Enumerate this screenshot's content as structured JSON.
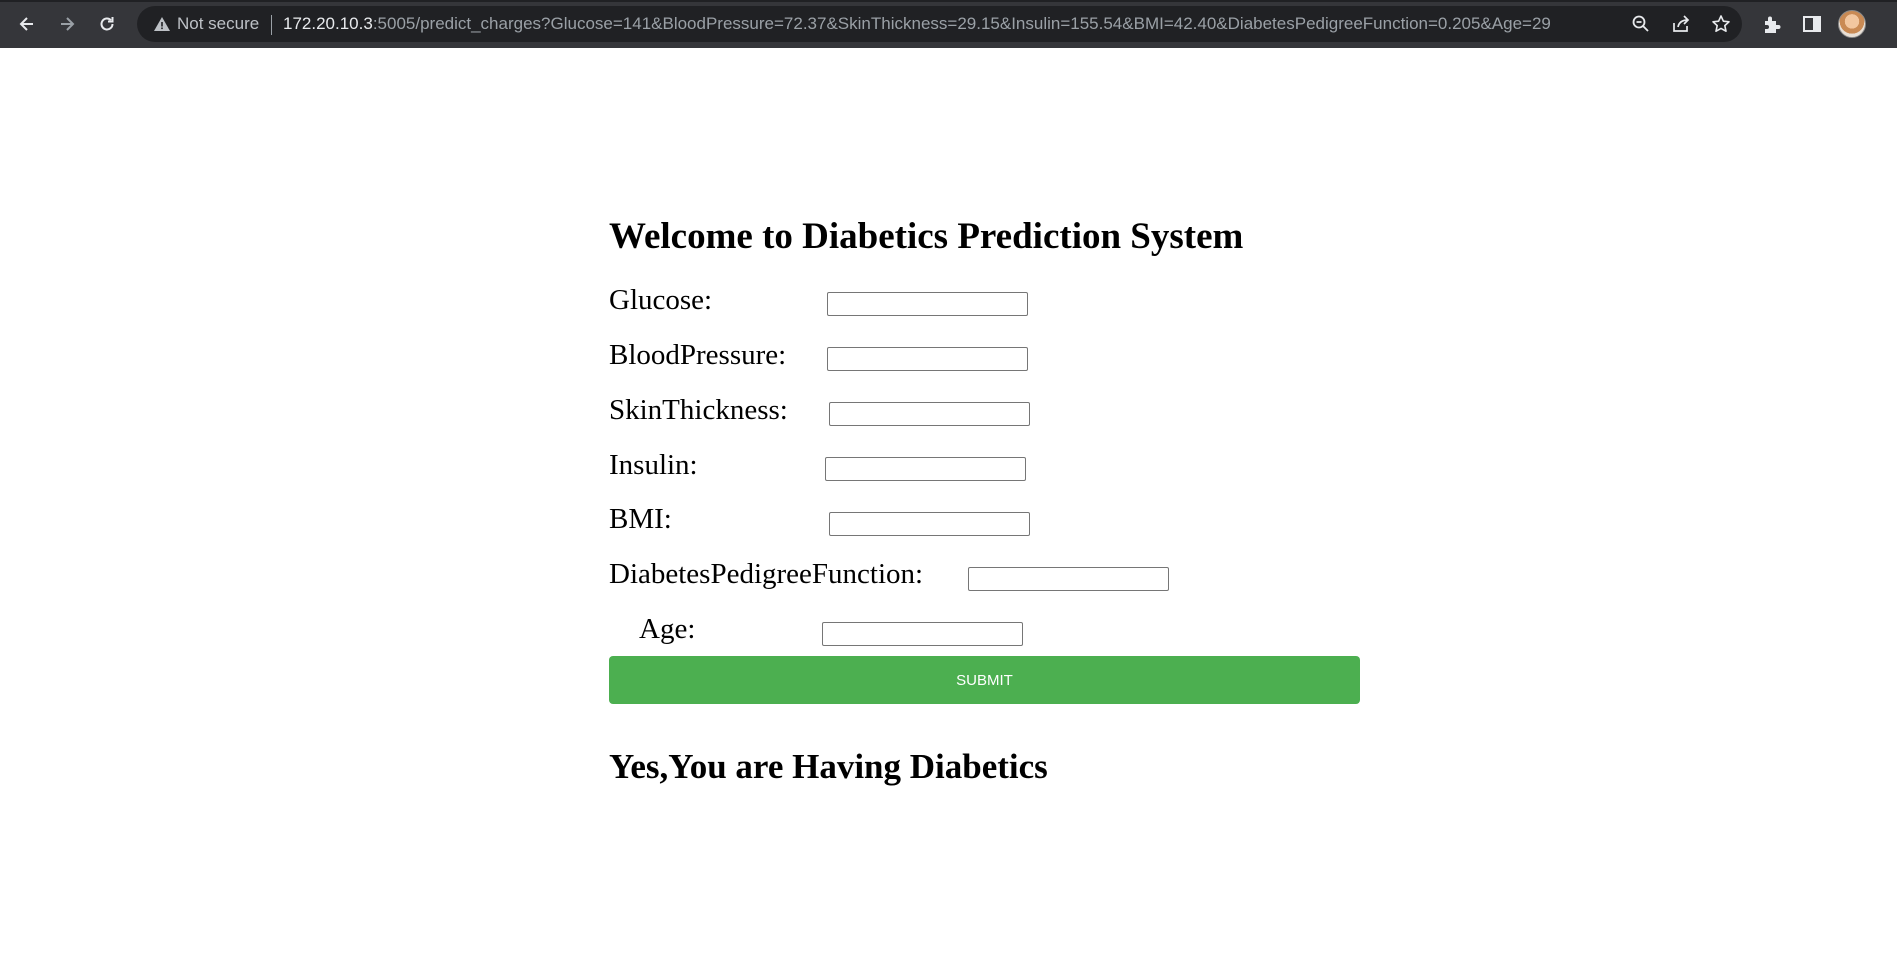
{
  "browser": {
    "security_label": "Not secure",
    "url_host": "172.20.10.3",
    "url_rest": ":5005/predict_charges?Glucose=141&BloodPressure=72.37&SkinThickness=29.15&Insulin=155.54&BMI=42.40&DiabetesPedigreeFunction=0.205&Age=29",
    "icons": [
      "back-icon",
      "forward-icon",
      "reload-icon",
      "warning-icon",
      "zoom-icon",
      "share-icon",
      "star-icon",
      "extensions-icon",
      "side-panel-icon",
      "profile-avatar"
    ]
  },
  "page": {
    "title": "Welcome to Diabetics Prediction System",
    "fields": [
      {
        "label": "Glucose:",
        "value": ""
      },
      {
        "label": "BloodPressure:",
        "value": ""
      },
      {
        "label": "SkinThickness:",
        "value": ""
      },
      {
        "label": "Insulin:",
        "value": ""
      },
      {
        "label": "BMI:",
        "value": ""
      },
      {
        "label": "DiabetesPedigreeFunction:",
        "value": ""
      },
      {
        "label": "Age:",
        "value": ""
      }
    ],
    "submit_label": "Submit",
    "result": "Yes,You are Having Diabetics"
  },
  "colors": {
    "submit_bg": "#4caf50",
    "chrome_bg": "#35363a",
    "omnibox_bg": "#202124"
  }
}
